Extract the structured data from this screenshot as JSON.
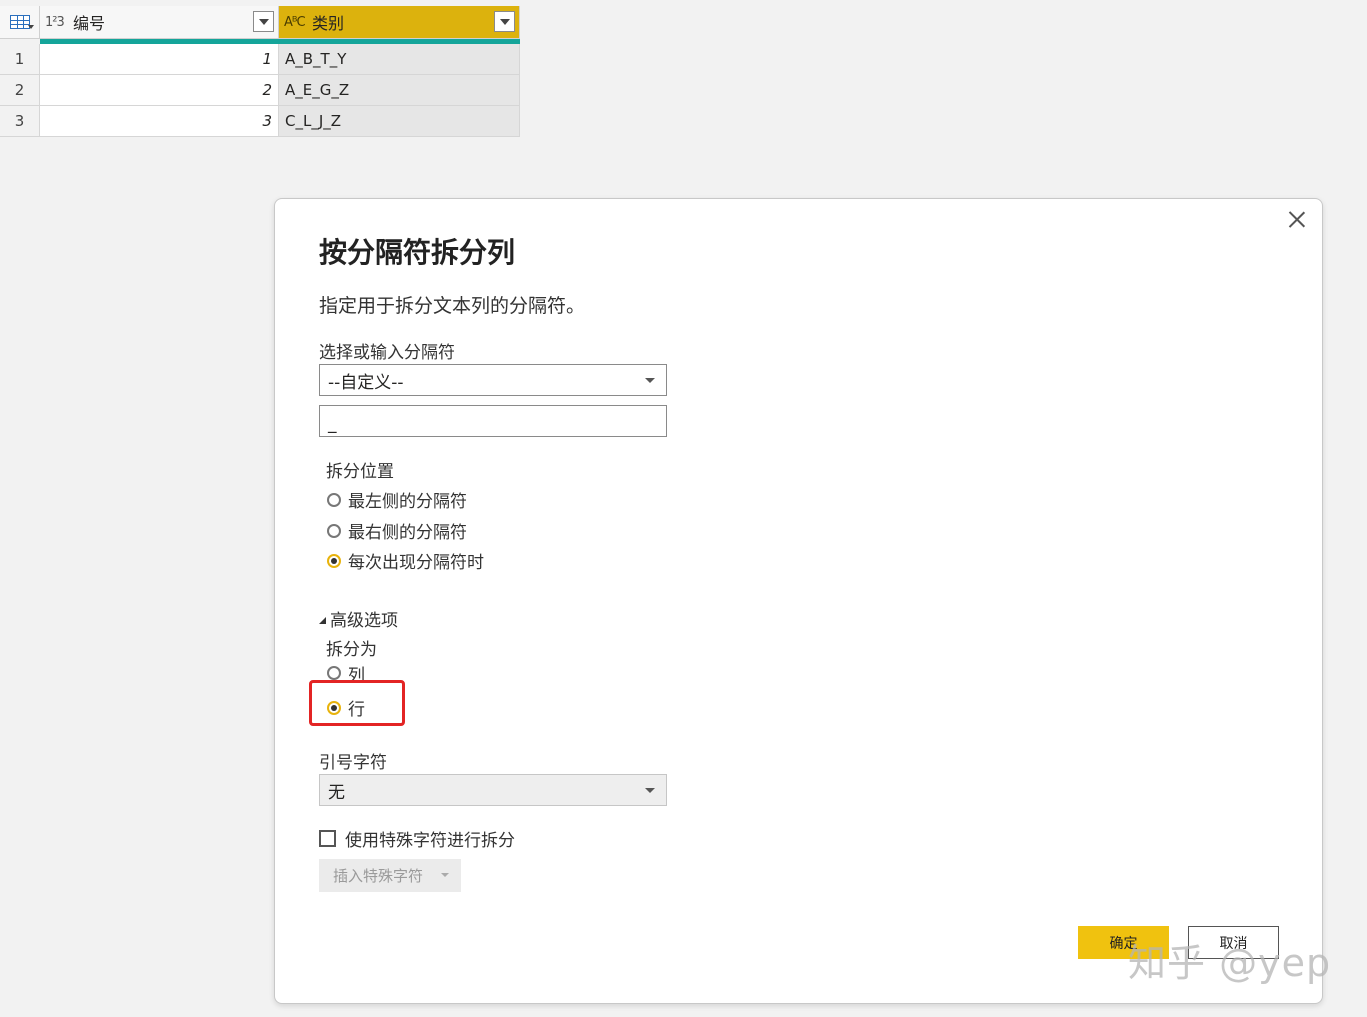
{
  "grid": {
    "columns": [
      {
        "type_icon": "1²3",
        "label": "编号"
      },
      {
        "type_icon": "AᴮC",
        "label": "类别"
      }
    ],
    "rows": [
      {
        "index": "1",
        "id": "1",
        "category": "A_B_T_Y"
      },
      {
        "index": "2",
        "id": "2",
        "category": "A_E_G_Z"
      },
      {
        "index": "3",
        "id": "3",
        "category": "C_L_J_Z"
      }
    ]
  },
  "dialog": {
    "title": "按分隔符拆分列",
    "description": "指定用于拆分文本列的分隔符。",
    "delimiter_label": "选择或输入分隔符",
    "delimiter_selected": "--自定义--",
    "delimiter_value": "_",
    "split_position_label": "拆分位置",
    "split_position_options": [
      "最左侧的分隔符",
      "最右侧的分隔符",
      "每次出现分隔符时"
    ],
    "split_position_selected": 2,
    "advanced_label": "高级选项",
    "split_into_label": "拆分为",
    "split_into_options": [
      "列",
      "行"
    ],
    "split_into_selected": 1,
    "quote_label": "引号字符",
    "quote_selected": "无",
    "special_chars_label": "使用特殊字符进行拆分",
    "insert_special_label": "插入特殊字符",
    "ok_label": "确定",
    "cancel_label": "取消"
  },
  "watermark": "知乎 @yep",
  "colors": {
    "accent": "#f0c20f",
    "header_selected": "#dcb20d",
    "quality_bar": "#15a59a",
    "highlight": "#e32424"
  }
}
